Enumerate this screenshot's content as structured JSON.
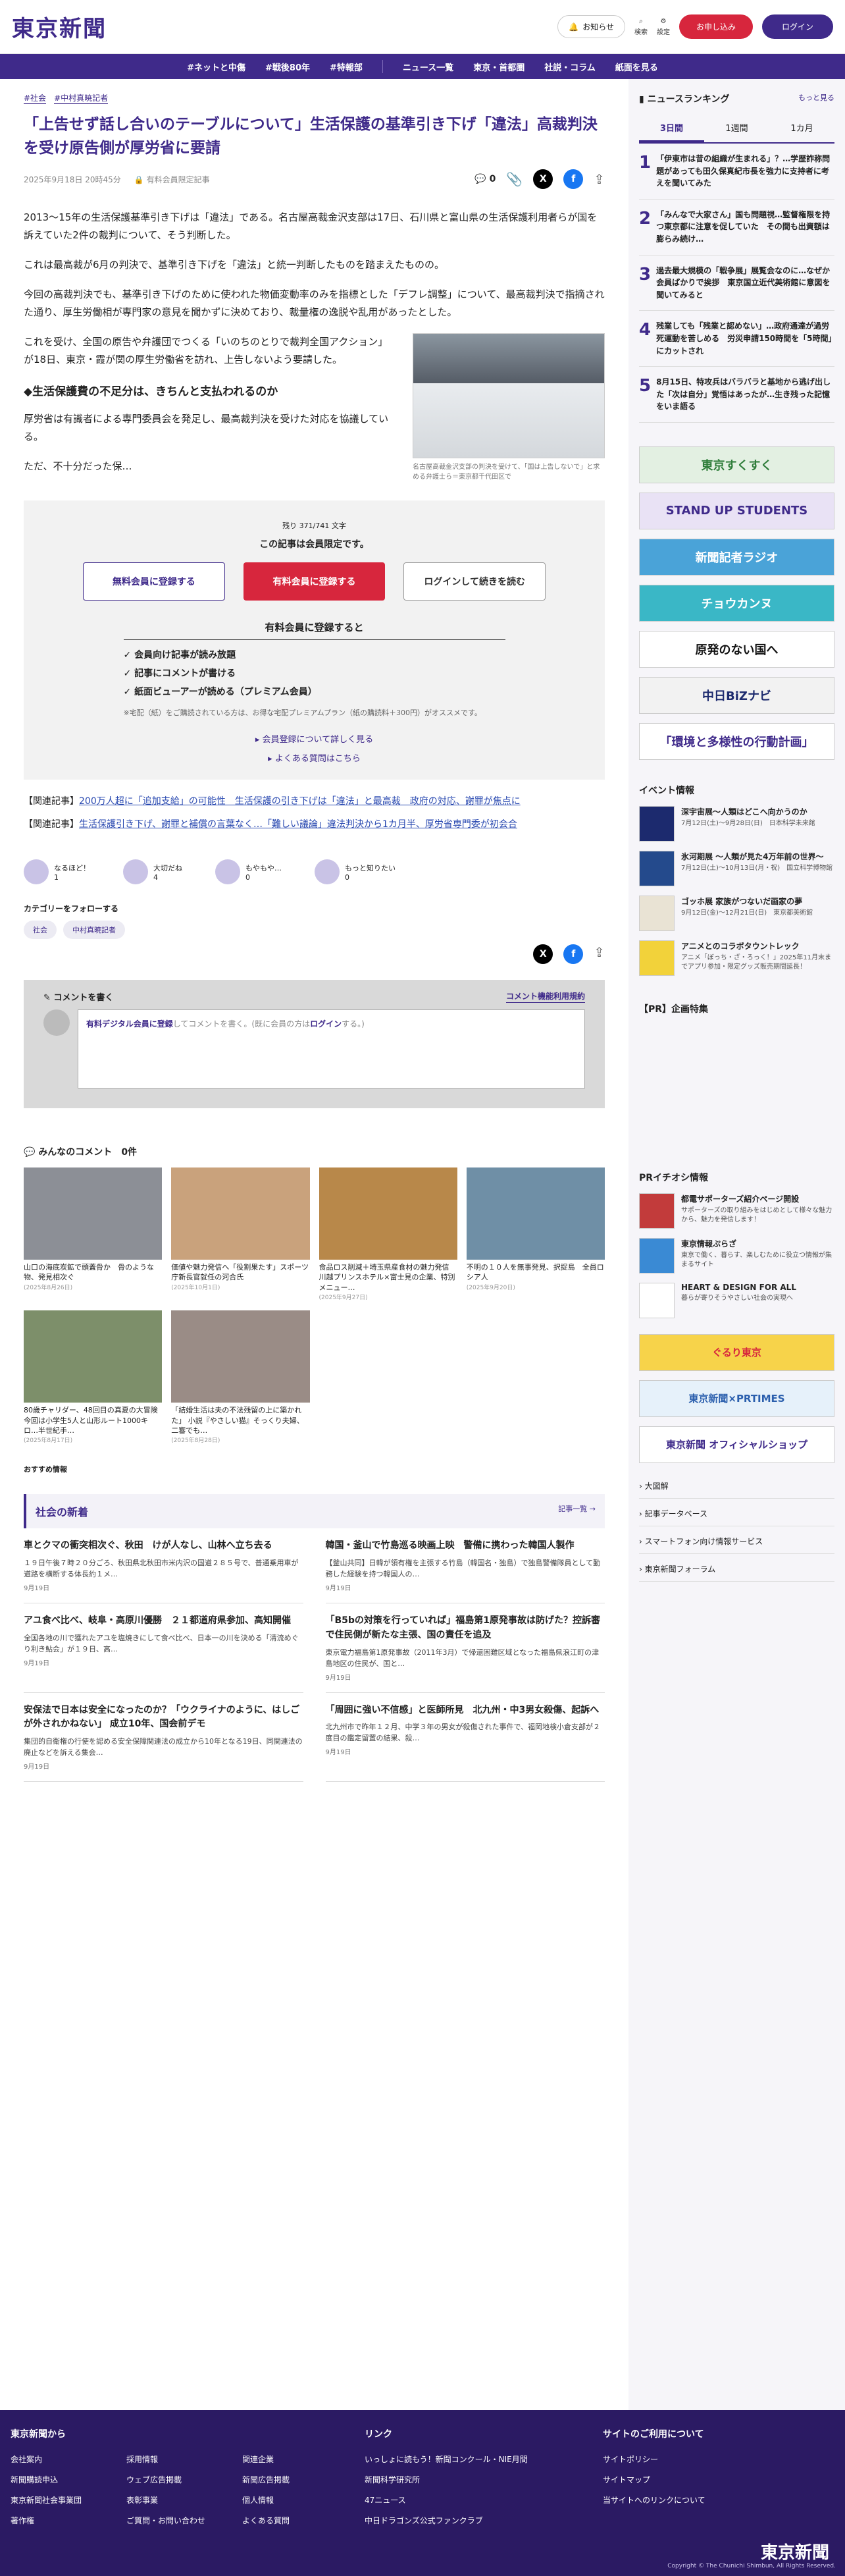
{
  "header": {
    "logo": "東京新聞",
    "notify": "お知らせ",
    "search": "検索",
    "settings": "設定",
    "register": "お申し込み",
    "login": "ログイン"
  },
  "nav": [
    "#ネットと中傷",
    "#戦後80年",
    "#特報部",
    "ニュース一覧",
    "東京・首都圏",
    "社説・コラム",
    "紙面を見る"
  ],
  "article": {
    "tags": [
      "#社会",
      "#中村真暁記者"
    ],
    "title": "「上告せず話し合いのテーブルについて」生活保護の基準引き下げ「違法」高裁判決を受け原告側が厚労省に要請",
    "date": "2025年9月18日 20時45分",
    "member": "有料会員限定記事",
    "comment_count": "0",
    "p1": "2013～15年の生活保護基準引き下げは「違法」である。名古屋高裁金沢支部は17日、石川県と富山県の生活保護利用者らが国を訴えていた2件の裁判について、そう判断した。",
    "p2": "これは最高裁が6月の判決で、基準引き下げを「違法」と統一判断したものを踏まえたものの。",
    "p3": "今回の高裁判決でも、基準引き下げのために使われた物価変動率のみを指標とした「デフレ調整」について、最高裁判決で指摘された通り、厚生労働相が専門家の意見を聞かずに決めており、裁量権の逸脱や乱用があったとした。",
    "p4": "これを受け、全国の原告や弁護団でつくる「いのちのとりで裁判全国アクション」が18日、東京・霞が関の厚生労働省を訪れ、上告しないよう要請した。",
    "h": "◆生活保護費の不足分は、きちんと支払われるのか",
    "p5": "厚労省は有識者による専門委員会を発足し、最高裁判決を受けた対応を協議している。",
    "p6": "ただ、不十分だった保…",
    "caption": "名古屋高裁金沢支部の判決を受けて、「国は上告しないで」と求める弁護士ら＝東京都千代田区で"
  },
  "pay": {
    "remain": "残り 371/741 文字",
    "limited": "この記事は会員限定です。",
    "free_btn": "無料会員に登録する",
    "paid_btn": "有料会員に登録する",
    "login_btn": "ログインして続きを読む",
    "merit_title": "有料会員に登録すると",
    "merits": [
      "会員向け記事が読み放題",
      "記事にコメントが書ける",
      "紙面ビューアーが読める（プレミアム会員）"
    ],
    "note": "※宅配（紙）をご購読されている方は、お得な宅配プレミアムプラン（紙の購読料＋300円）がオススメです。",
    "link1": "会員登録について詳しく見る",
    "link2": "よくある質問はこちら"
  },
  "related": [
    {
      "label": "【関連記事】",
      "text": "200万人超に「追加支給」の可能性　生活保護の引き下げは「違法」と最高裁　政府の対応、謝罪が焦点に"
    },
    {
      "label": "【関連記事】",
      "text": "生活保護引き下げ、謝罪と補償の言葉なく…「難しい議論」違法判決から1カ月半、厚労省専門委が初会合"
    }
  ],
  "reactions": [
    {
      "label": "なるほど！",
      "count": "1"
    },
    {
      "label": "大切だね",
      "count": "4"
    },
    {
      "label": "もやもや…",
      "count": "0"
    },
    {
      "label": "もっと知りたい",
      "count": "0"
    }
  ],
  "follow": {
    "title": "カテゴリーをフォローする",
    "tags": [
      "社会",
      "中村真暁記者"
    ]
  },
  "comment": {
    "title": "コメントを書く",
    "rules": "コメント機能利用規約",
    "placeholder_1": "有料デジタル会員に登録",
    "placeholder_2": "してコメントを書く。(既に会員の方は",
    "placeholder_3": "ログイン",
    "placeholder_4": "する。)"
  },
  "comments": {
    "title": "みんなのコメント",
    "count": "0件"
  },
  "thumbs": [
    {
      "title": "山口の海底炭鉱で頭蓋骨か　骨のような物、発見相次ぐ",
      "date": "(2025年8月26日)",
      "color": "#8c8f96"
    },
    {
      "title": "価値や魅力発信へ「役割果たす」スポーツ庁新長官就任の河合氏",
      "date": "(2025年10月1日)",
      "color": "#c9a27c"
    },
    {
      "title": "食品ロス削減＋埼玉県産食材の魅力発信　川越プリンスホテル×富士見の企業、特別メニュー…",
      "date": "(2025年9月27日)",
      "color": "#b8884a"
    },
    {
      "title": "不明の１０人を無事発見、択捉島　全員ロシア人",
      "date": "(2025年9月20日)",
      "color": "#6f8fa6"
    },
    {
      "title": "80歳チャリダー、48回目の真夏の大冒険　今回は小学生5人と山形ルート1000キロ…半世紀手…",
      "date": "(2025年8月17日)",
      "color": "#7d8f6a"
    },
    {
      "title": "「結婚生活は夫の不法残留の上に築かれた」 小説『やさしい猫』そっくり夫婦、二審でも…",
      "date": "(2025年8月28日)",
      "color": "#9a8c86"
    }
  ],
  "osusume": "おすすめ情報",
  "news": {
    "title": "社会の新着",
    "more": "記事一覧",
    "items": [
      {
        "title": "車とクマの衝突相次ぐ、秋田　けが人なし、山林へ立ち去る",
        "body": "１９日午後７時２０分ごろ、秋田県北秋田市米内沢の国道２８５号で、普通乗用車が道路を横断する体長約１メ…",
        "date": "9月19日"
      },
      {
        "title": "韓国・釜山で竹島巡る映画上映　警備に携わった韓国人製作",
        "body": "【釜山共同】日韓が領有権を主張する竹島（韓国名・独島）で独島警備隊員として勤務した経験を持つ韓国人の…",
        "date": "9月19日"
      },
      {
        "title": "アユ食べ比べ、岐阜・高原川優勝　２１都道府県参加、高知開催",
        "body": "全国各地の川で獲れたアユを塩焼きにして食べ比べ、日本一の川を決める「清流めぐり利き鮎会」が１９日、高…",
        "date": "9月19日"
      },
      {
        "title": "「B5bの対策を行っていれば」福島第1原発事故は防げた？控訴審で住民側が新たな主張、国の責任を追及",
        "body": "東京電力福島第1原発事故（2011年3月）で帰還困難区域となった福島県浪江町の津島地区の住民が、国と…",
        "date": "9月19日"
      },
      {
        "title": "安保法で日本は安全になったのか？「ウクライナのように、はしごが外されかねない」 成立10年、国会前デモ",
        "body": "集団的自衛権の行使を認める安全保障関連法の成立から10年となる19日、同関連法の廃止などを訴える集会…",
        "date": "9月19日"
      },
      {
        "title": "「周囲に強い不信感」と医師所見　北九州・中3男女殺傷、起訴へ",
        "body": "北九州市で昨年１２月、中学３年の男女が殺傷された事件で、福岡地検小倉支部が２度目の鑑定留置の結果、殺…",
        "date": "9月19日"
      }
    ]
  },
  "ranking": {
    "title": "ニュースランキング",
    "more": "もっと見る",
    "tabs": [
      "3日間",
      "1週間",
      "1カ月"
    ],
    "items": [
      {
        "n": "1",
        "t": "「伊東市は昔の組織が生まれる」？…学歴詐称問題があっても田久保真紀市長を強力に支持者に考えを聞いてみた"
      },
      {
        "n": "2",
        "t": "「みんなで大家さん」国も問題視…監督権限を持つ東京都に注意を促していた　その間も出資額は膨らみ続け…"
      },
      {
        "n": "3",
        "t": "過去最大規模の「戦争展」展覧会なのに…なぜか会員ばかりで挨拶　東京国立近代美術館に意図を聞いてみると"
      },
      {
        "n": "4",
        "t": "残業しても「残業と認めない」…政府通達が過労死運動を苦しめる　労災申請150時間を「5時間」にカットされ"
      },
      {
        "n": "5",
        "t": "8月15日、特攻兵はバラバラと基地から逃げ出した「次は自分」覚悟はあったが…生き残った記憶をいま語る"
      }
    ]
  },
  "banners": [
    "東京すくすく",
    "STAND UP STUDENTS",
    "新聞記者ラジオ",
    "チョウカンヌ",
    "原発のない国へ",
    "中日BiZナビ",
    "「環境と多様性の行動計画」"
  ],
  "events": {
    "title": "イベント情報",
    "items": [
      {
        "t": "深宇宙展～人類はどこへ向かうのか",
        "s": "7月12日(土)～9月28日(日)　日本科学未来館",
        "c": "#1c2a6e"
      },
      {
        "t": "氷河期展 ～人類が見た4万年前の世界～",
        "s": "7月12日(土)～10月13日(月・祝)　国立科学博物館",
        "c": "#244a8c"
      },
      {
        "t": "ゴッホ展 家族がつないだ画家の夢",
        "s": "9月12日(金)～12月21日(日)　東京都美術館",
        "c": "#e9e3d4"
      },
      {
        "t": "アニメとのコラボタウントレック",
        "s": "アニメ「ぼっち・ざ・ろっく！」2025年11月末までアプリ参加・限定グッズ販売期間延長！",
        "c": "#f2d23a"
      }
    ]
  },
  "pr": {
    "title": "【PR】企画特集"
  },
  "prtimes": {
    "title": "PRイチオシ情報",
    "items": [
      {
        "t": "都電サポーターズ紹介ページ開設",
        "s": "サポーターズの取り組みをはじめとして様々な魅力から、魅力を発信します！",
        "c": "#c23b3b"
      },
      {
        "t": "東京情報ぷらざ",
        "s": "東京で働く、暮らす、楽しむために役立つ情報が集まるサイト",
        "c": "#3a8ad4"
      },
      {
        "t": "HEART & DESIGN FOR ALL",
        "s": "暮らが寄りそうやさしい社会の実現へ",
        "c": "#ffffff"
      }
    ]
  },
  "banners2": [
    "ぐるり東京",
    "東京新聞×PRTIMES",
    "東京新聞 オフィシャルショップ"
  ],
  "side_links": [
    "大図解",
    "記事データベース",
    "スマートフォン向け情報サービス",
    "東京新聞フォーラム"
  ],
  "footer": {
    "c1": "東京新聞から",
    "c1links": [
      "会社案内",
      "採用情報",
      "関連企業",
      "新聞購読申込",
      "ウェブ広告掲載",
      "新聞広告掲載",
      "東京新聞社会事業団",
      "表彰事業",
      "個人情報",
      "著作権",
      "ご質問・お問い合わせ",
      "よくある質問"
    ],
    "c2": "リンク",
    "c2links": [
      "いっしょに読もう！新聞コンクール・NIE月間",
      "新聞科学研究所",
      "47ニュース",
      "中日ドラゴンズ公式ファンクラブ"
    ],
    "c3": "サイトのご利用について",
    "c3links": [
      "サイトポリシー",
      "サイトマップ",
      "当サイトへのリンクについて"
    ],
    "logo": "東京新聞",
    "copyright": "Copyright © The Chunichi Shimbun, All Rights Reserved."
  }
}
